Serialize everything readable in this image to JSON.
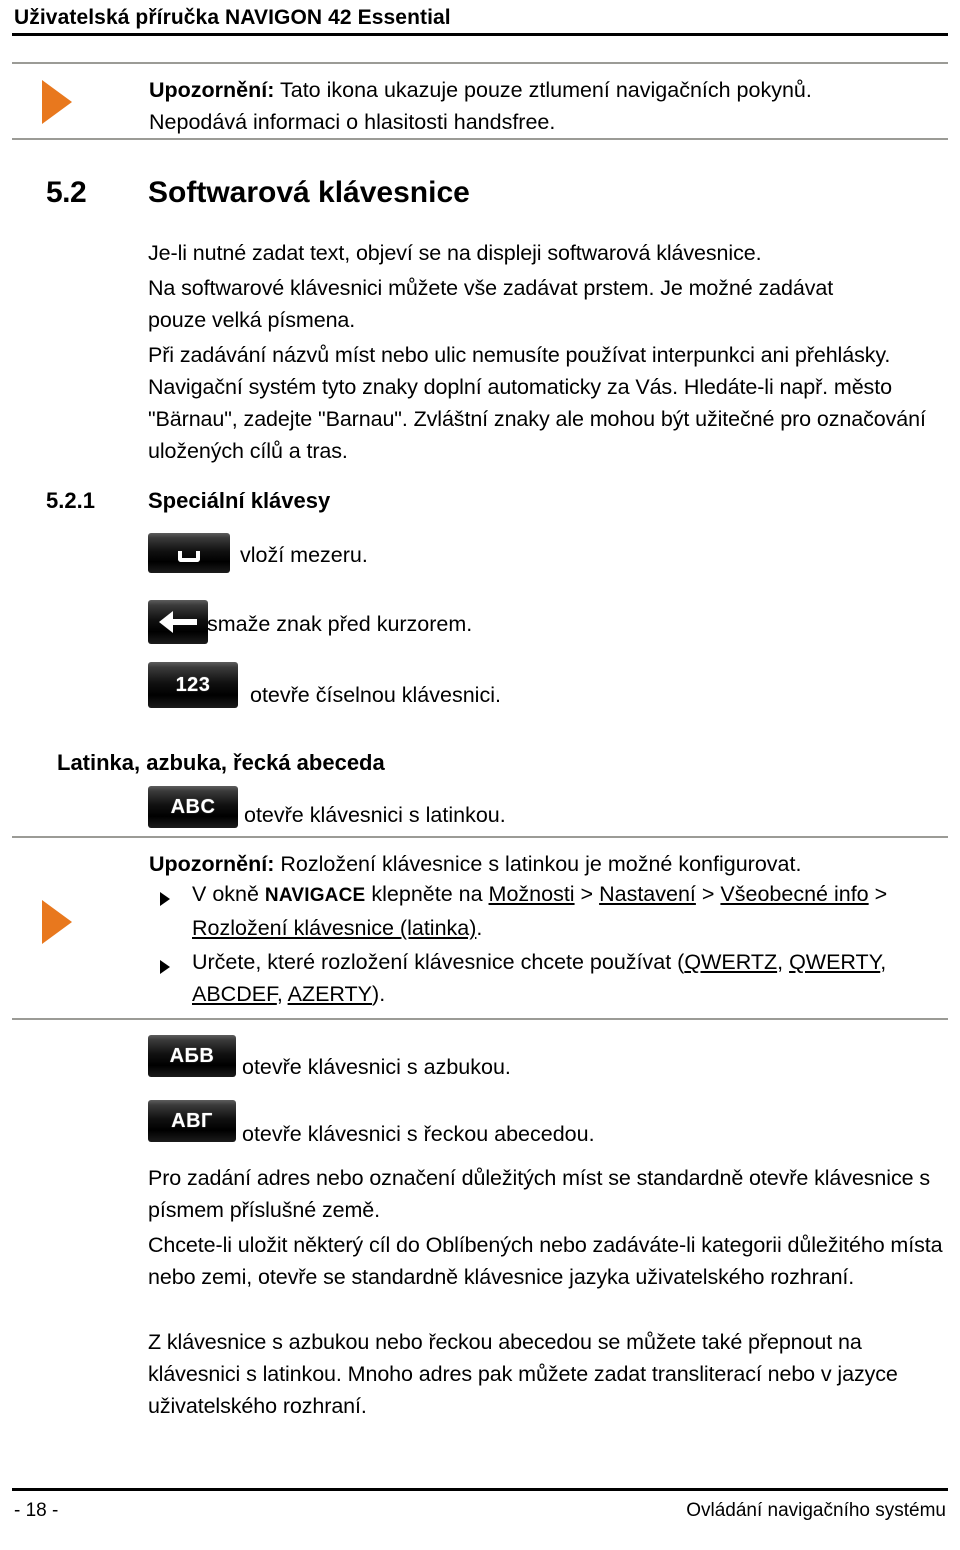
{
  "header": {
    "running_title": "Uživatelská příručka NAVIGON 42 Essential"
  },
  "notes": [
    {
      "marker_icon": "orange-triangle-marker",
      "marker_color": "#E8781E",
      "label": "Upozornění:",
      "line1": " Tato ikona ukazuje pouze ztlumení navigačních pokynů.",
      "line2": "Nepodává informaci o hlasitosti handsfree."
    }
  ],
  "section": {
    "number": "5.2",
    "title": "Softwarová klávesnice",
    "paragraphs": [
      "Je-li nutné zadat text, objeví se na displeji softwarová klávesnice.",
      "Na softwarové klávesnici můžete vše zadávat prstem. Je možné zadávat pouze velká písmena.",
      "Při zadávání názvů míst nebo ulic nemusíte používat interpunkci ani přehlásky. Navigační systém tyto znaky doplní automaticky za Vás. Hledáte-li např. město \"Bärnau\", zadejte \"Barnau\". Zvláštní znaky ale mohou být užitečné pro označování uložených cílů a tras."
    ]
  },
  "subsection": {
    "number": "5.2.1",
    "title": "Speciální klávesy"
  },
  "special_keys": [
    {
      "icon": "space-key-icon",
      "label": "",
      "caption": "vloží mezeru."
    },
    {
      "icon": "backspace-key-icon",
      "label": "",
      "caption": "smaže znak před kurzorem."
    },
    {
      "icon": "numeric-key-icon",
      "label": "123",
      "caption": "otevře číselnou klávesnici."
    }
  ],
  "alphabets": {
    "heading": "Latinka, azbuka, řecká abeceda",
    "latin_key": {
      "icon": "latin-key-icon",
      "label": "ABC",
      "caption": "otevře klávesnici s latinkou."
    },
    "note": {
      "marker_icon": "orange-triangle-marker",
      "marker_color": "#E8781E",
      "label": "Upozornění:",
      "text": " Rozložení klávesnice s latinkou je možné konfigurovat.",
      "bullets": [
        {
          "icon": "bullet-triangle-icon",
          "parts": [
            {
              "t": "V okně ",
              "style": "plain"
            },
            {
              "t": "NAVIGACE",
              "style": "smallcaps"
            },
            {
              "t": " klepněte na ",
              "style": "plain"
            },
            {
              "t": "Možnosti",
              "style": "underline"
            },
            {
              "t": " > ",
              "style": "plain"
            },
            {
              "t": "Nastavení",
              "style": "underline"
            },
            {
              "t": " > ",
              "style": "plain"
            },
            {
              "t": "Všeobecné info",
              "style": "underline"
            },
            {
              "t": " > ",
              "style": "plain"
            },
            {
              "t": "Rozložení klávesnice (latinka)",
              "style": "underline"
            },
            {
              "t": ".",
              "style": "plain"
            }
          ]
        },
        {
          "icon": "bullet-triangle-icon",
          "parts": [
            {
              "t": "Určete, které rozložení klávesnice chcete používat (",
              "style": "plain"
            },
            {
              "t": "QWERTZ",
              "style": "underline"
            },
            {
              "t": ", ",
              "style": "plain"
            },
            {
              "t": "QWERTY",
              "style": "underline"
            },
            {
              "t": ", ",
              "style": "plain"
            },
            {
              "t": "ABCDEF",
              "style": "underline"
            },
            {
              "t": ", ",
              "style": "plain"
            },
            {
              "t": "AZERTY",
              "style": "underline"
            },
            {
              "t": ").",
              "style": "plain"
            }
          ]
        }
      ]
    },
    "cyrillic_key": {
      "icon": "cyrillic-key-icon",
      "label": "АБВ",
      "caption": "otevře klávesnici s azbukou."
    },
    "greek_key": {
      "icon": "greek-key-icon",
      "label": "АВГ",
      "caption": "otevře klávesnici s řeckou abecedou."
    },
    "paragraphs": [
      "Pro zadání adres nebo označení důležitých míst se standardně otevře klávesnice s písmem příslušné země.",
      "Chcete-li uložit některý cíl do Oblíbených nebo zadáváte-li kategorii důležitého místa nebo zemi, otevře se standardně klávesnice jazyka uživatelského rozhraní.",
      "Z klávesnice s azbukou nebo řeckou abecedou se můžete také přepnout na klávesnici s latinkou. Mnoho adres pak můžete zadat transliterací nebo v jazyce uživatelského rozhraní."
    ]
  },
  "footer": {
    "page_number": "- 18 -",
    "chapter": "Ovládání navigačního systému"
  }
}
